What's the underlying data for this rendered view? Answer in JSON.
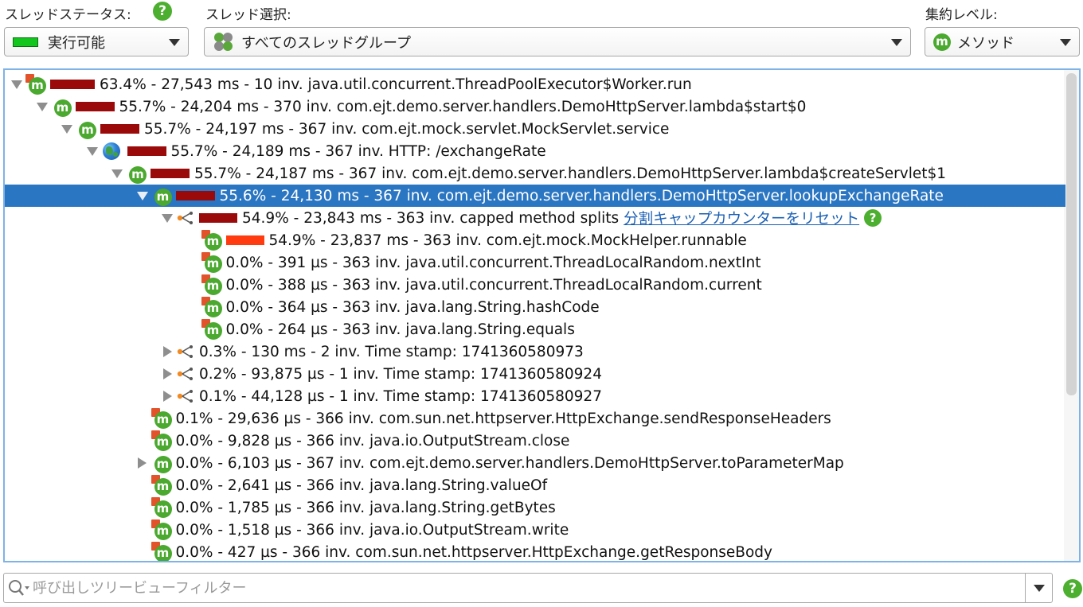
{
  "thread_status": {
    "label": "スレッドステータス:",
    "value": "実行可能",
    "swatch_color": "#12c61e"
  },
  "thread_select": {
    "label": "スレッド選択:",
    "value": "すべてのスレッドグループ"
  },
  "aggregation": {
    "label": "集約レベル:",
    "value": "メソッド"
  },
  "help_glyph": "?",
  "method_glyph": "m",
  "tree": {
    "rows": [
      {
        "text": "63.4% - 27,543 ms - 10 inv. java.util.concurrent.ThreadPoolExecutor$Worker.run",
        "depth": 0,
        "toggle": "down",
        "icon": "method",
        "bar": 0.634,
        "bar_color": "dark"
      },
      {
        "text": "55.7% - 24,204 ms - 370 inv. com.ejt.demo.server.handlers.DemoHttpServer.lambda$start$0",
        "depth": 1,
        "toggle": "down",
        "icon": "method-plain",
        "bar": 0.557,
        "bar_color": "dark"
      },
      {
        "text": "55.7% - 24,197 ms - 367 inv. com.ejt.mock.servlet.MockServlet.service",
        "depth": 2,
        "toggle": "down",
        "icon": "method-plain",
        "bar": 0.557,
        "bar_color": "dark"
      },
      {
        "text": "55.7% - 24,189 ms - 367 inv. HTTP: /exchangeRate",
        "depth": 3,
        "toggle": "down",
        "icon": "globe",
        "bar": 0.557,
        "bar_color": "dark"
      },
      {
        "text": "55.7% - 24,187 ms - 367 inv. com.ejt.demo.server.handlers.DemoHttpServer.lambda$createServlet$1",
        "depth": 4,
        "toggle": "down",
        "icon": "method-plain",
        "bar": 0.557,
        "bar_color": "dark"
      },
      {
        "text": "55.6% - 24,130 ms - 367 inv. com.ejt.demo.server.handlers.DemoHttpServer.lookupExchangeRate",
        "depth": 5,
        "toggle": "down",
        "icon": "method-plain",
        "bar": 0.556,
        "bar_color": "dark",
        "selected": true
      },
      {
        "text": "54.9% - 23,843 ms - 363 inv. capped method splits",
        "depth": 6,
        "toggle": "down",
        "icon": "split",
        "bar": 0.549,
        "bar_color": "dark",
        "link": "分割キャップカウンターをリセット",
        "help": true
      },
      {
        "text": "54.9% - 23,837 ms - 363 inv. com.ejt.mock.MockHelper.runnable",
        "depth": 7,
        "toggle": "none",
        "icon": "method",
        "bar": 0.549,
        "bar_color": "bright"
      },
      {
        "text": "0.0% - 391 µs - 363 inv. java.util.concurrent.ThreadLocalRandom.nextInt",
        "depth": 7,
        "toggle": "none",
        "icon": "method",
        "bar": 0
      },
      {
        "text": "0.0% - 388 µs - 363 inv. java.util.concurrent.ThreadLocalRandom.current",
        "depth": 7,
        "toggle": "none",
        "icon": "method",
        "bar": 0
      },
      {
        "text": "0.0% - 364 µs - 363 inv. java.lang.String.hashCode",
        "depth": 7,
        "toggle": "none",
        "icon": "method",
        "bar": 0
      },
      {
        "text": "0.0% - 264 µs - 363 inv. java.lang.String.equals",
        "depth": 7,
        "toggle": "none",
        "icon": "method",
        "bar": 0
      },
      {
        "text": "0.3% - 130 ms - 2 inv. Time stamp: 1741360580973",
        "depth": 6,
        "toggle": "right",
        "icon": "split",
        "bar": 0
      },
      {
        "text": "0.2% - 93,875 µs - 1 inv. Time stamp: 1741360580924",
        "depth": 6,
        "toggle": "right",
        "icon": "split",
        "bar": 0
      },
      {
        "text": "0.1% - 44,128 µs - 1 inv. Time stamp: 1741360580927",
        "depth": 6,
        "toggle": "right",
        "icon": "split",
        "bar": 0
      },
      {
        "text": "0.1% - 29,636 µs - 366 inv. com.sun.net.httpserver.HttpExchange.sendResponseHeaders",
        "depth": 5,
        "toggle": "none",
        "icon": "method",
        "bar": 0
      },
      {
        "text": "0.0% - 9,828 µs - 366 inv. java.io.OutputStream.close",
        "depth": 5,
        "toggle": "none",
        "icon": "method",
        "bar": 0
      },
      {
        "text": "0.0% - 6,103 µs - 367 inv. com.ejt.demo.server.handlers.DemoHttpServer.toParameterMap",
        "depth": 5,
        "toggle": "right",
        "icon": "method-plain",
        "bar": 0
      },
      {
        "text": "0.0% - 2,641 µs - 366 inv. java.lang.String.valueOf",
        "depth": 5,
        "toggle": "none",
        "icon": "method",
        "bar": 0
      },
      {
        "text": "0.0% - 1,785 µs - 366 inv. java.lang.String.getBytes",
        "depth": 5,
        "toggle": "none",
        "icon": "method",
        "bar": 0
      },
      {
        "text": "0.0% - 1,518 µs - 366 inv. java.io.OutputStream.write",
        "depth": 5,
        "toggle": "none",
        "icon": "method",
        "bar": 0
      },
      {
        "text": "0.0% - 427 µs - 366 inv. com.sun.net.httpserver.HttpExchange.getResponseBody",
        "depth": 5,
        "toggle": "none",
        "icon": "method",
        "bar": 0
      }
    ]
  },
  "filter": {
    "placeholder": "呼び出しツリービューフィルター"
  }
}
